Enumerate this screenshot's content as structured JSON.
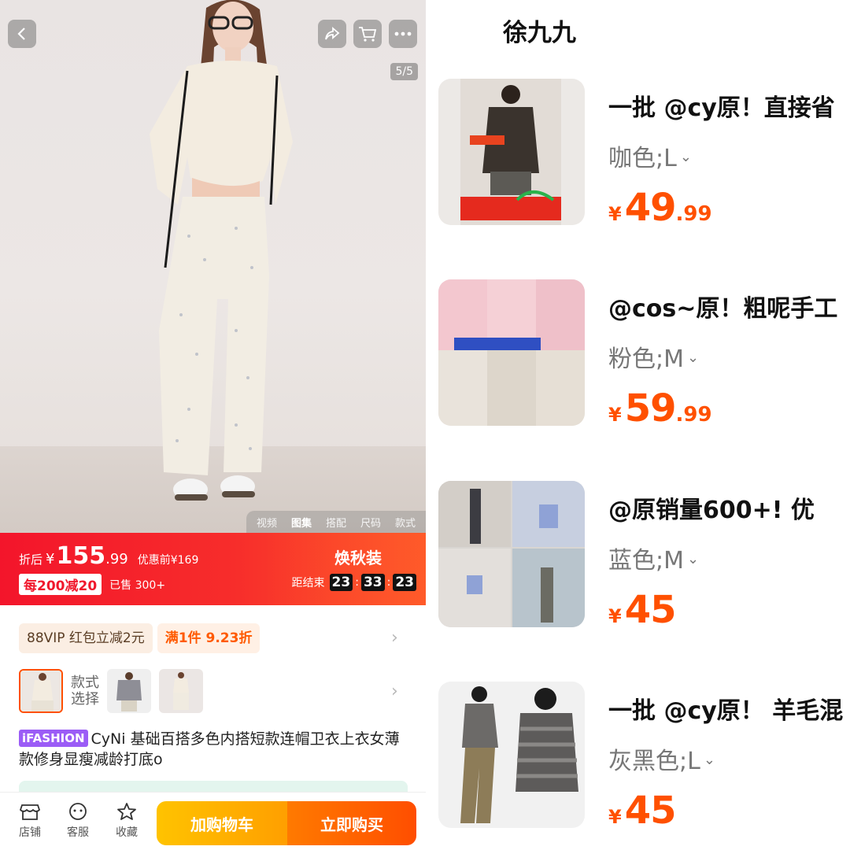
{
  "left": {
    "image_counter": "5/5",
    "media_tabs": [
      "视频",
      "图集",
      "搭配",
      "尺码",
      "款式"
    ],
    "active_media_tab": "图集",
    "price": {
      "after_label": "折后",
      "currency": "¥",
      "integer": "155",
      "decimal": ".99",
      "before_label": "优惠前¥169",
      "coupon": "每200减20",
      "sold": "已售 300+",
      "campaign": "焕秋装",
      "countdown_label": "距结束",
      "countdown": [
        "23",
        "33",
        "23"
      ]
    },
    "promos": [
      "88VIP 红包立减2元",
      "满1件 9.23折"
    ],
    "style_label_1": "款式",
    "style_label_2": "选择",
    "title_badge": "iFASHION",
    "title": "CyNi 基础百搭多色内搭短款连帽卫衣上衣女薄款修身显瘦减龄打底o",
    "bottom_nav": [
      {
        "label": "店铺",
        "icon": "store-icon"
      },
      {
        "label": "客服",
        "icon": "service-icon"
      },
      {
        "label": "收藏",
        "icon": "star-icon"
      }
    ],
    "add_to_cart": "加购物车",
    "buy_now": "立即购买"
  },
  "right": {
    "shop_name": "徐九九",
    "orders": [
      {
        "title": "一批 @cy原！直接省",
        "spec": "咖色;L",
        "currency": "¥",
        "integer": "49",
        "decimal": ".99"
      },
      {
        "title": "@cos~原！粗呢手工",
        "spec": "粉色;M",
        "currency": "¥",
        "integer": "59",
        "decimal": ".99"
      },
      {
        "title": "@原销量600+!  优",
        "spec": "蓝色;M",
        "currency": "¥",
        "integer": "45",
        "decimal": ""
      },
      {
        "title": "一批 @cy原！ 羊毛混",
        "spec": "灰黑色;L",
        "currency": "¥",
        "integer": "45",
        "decimal": ""
      }
    ]
  },
  "colors": {
    "price_red": "#f3152b",
    "accent_orange": "#ff5000",
    "cart_yellow": "#ffc300",
    "ifashion_purple": "#9b5cf6"
  }
}
